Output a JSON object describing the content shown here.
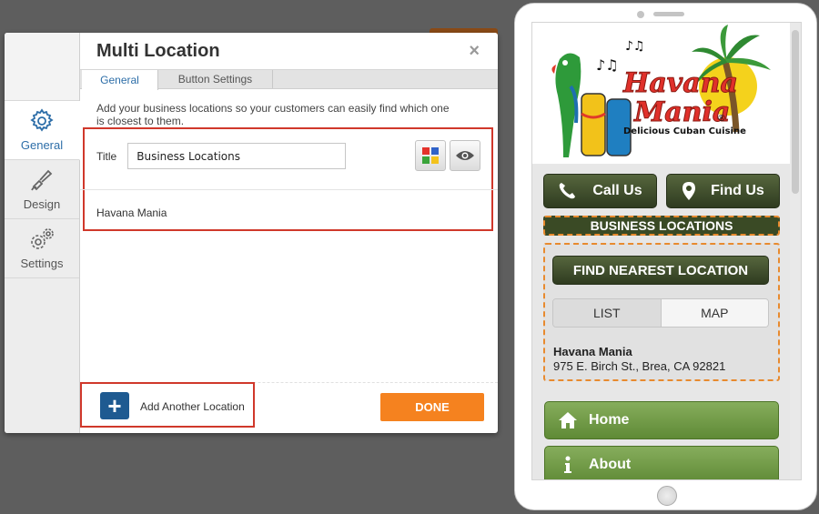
{
  "editor": {
    "title": "Multi Location",
    "close_label": "×",
    "sidebar": [
      {
        "label": "General",
        "icon": "gear-icon",
        "active": true
      },
      {
        "label": "Design",
        "icon": "paintbrush-icon",
        "active": false
      },
      {
        "label": "Settings",
        "icon": "gears-icon",
        "active": false
      }
    ],
    "tabs": [
      {
        "label": "General",
        "active": true
      },
      {
        "label": "Button Settings",
        "active": false
      }
    ],
    "description": "Add your business locations so your customers can easily find which one is closest to them.",
    "title_label": "Title",
    "title_value": "Business Locations",
    "locations": [
      "Havana Mania"
    ],
    "add_location_label": "Add Another Location",
    "add_icon": "+",
    "done_label": "DONE",
    "colors": {
      "accent": "#2d6ea8",
      "done": "#f5821f",
      "highlight": "#d0382b",
      "add": "#1e5a91"
    }
  },
  "preview": {
    "logo": {
      "line1": "Havana",
      "line2": "Mania",
      "registered": "®",
      "tagline": "Delicious Cuban Cuisine"
    },
    "call_label": "Call Us",
    "find_label": "Find Us",
    "section_title": "BUSINESS LOCATIONS",
    "nearest_label": "FIND NEAREST LOCATION",
    "segment": [
      "LIST",
      "MAP"
    ],
    "location_name": "Havana Mania",
    "location_address": "975 E. Birch St., Brea, CA 92821",
    "nav": [
      {
        "label": "Home",
        "icon": "home-icon"
      },
      {
        "label": "About",
        "icon": "info-icon"
      }
    ],
    "colors": {
      "dark_green": "#3a4a25",
      "green": "#6f9a44",
      "dashed": "#e88a2e"
    }
  }
}
